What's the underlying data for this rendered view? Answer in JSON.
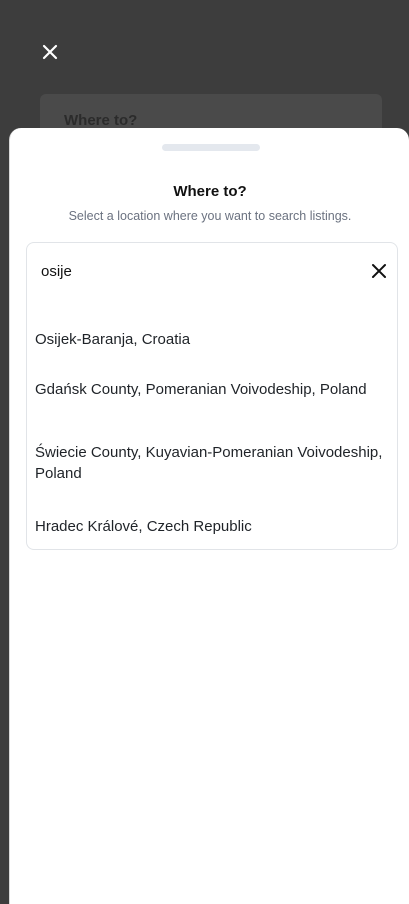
{
  "background": {
    "card_title": "Where to?"
  },
  "sheet": {
    "title": "Where to?",
    "subtitle": "Select a location where you want to search listings."
  },
  "search": {
    "value": "osije",
    "clear_icon": "close-icon"
  },
  "results": [
    {
      "label": "Osijek-Baranja, Croatia"
    },
    {
      "label": "Gdańsk County, Pomeranian Voivodeship, Poland"
    },
    {
      "label": "Świecie County, Kuyavian-Pomeranian Voivodeship, Poland"
    },
    {
      "label": "Hradec Králové, Czech Republic"
    }
  ],
  "colors": {
    "backdrop": "#3d3d3d",
    "text": "#111111",
    "muted": "#6b7280",
    "border": "#e1e4e8"
  }
}
